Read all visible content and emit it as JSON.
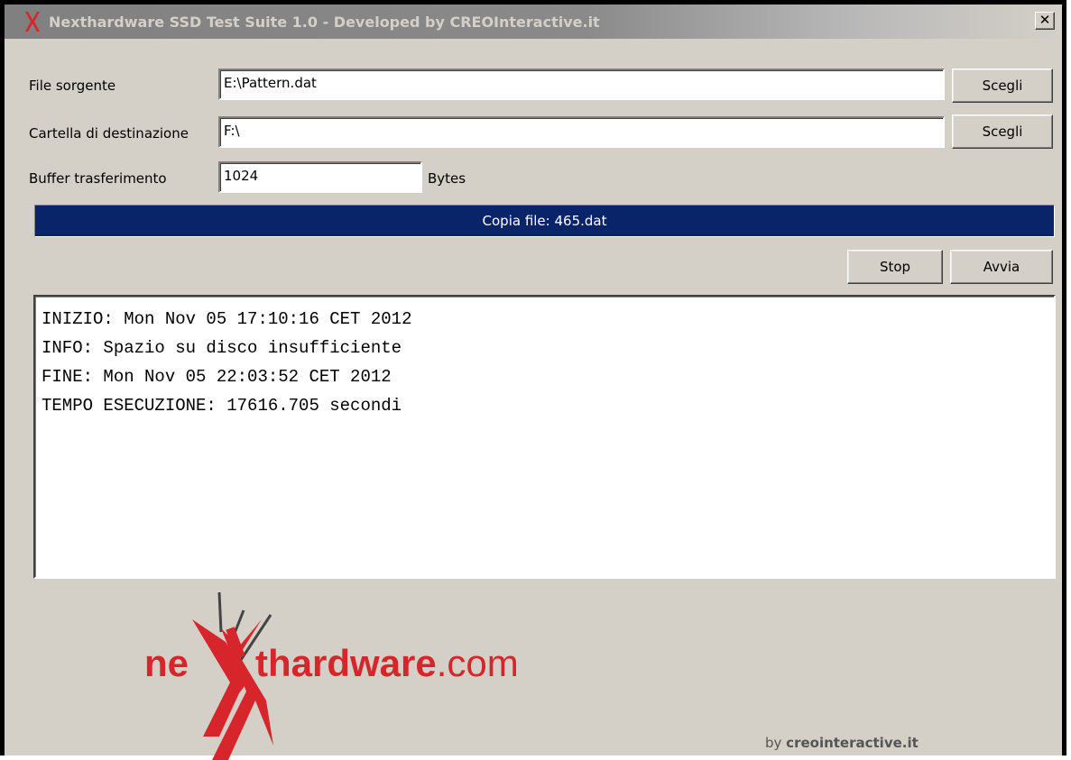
{
  "window": {
    "title": "Nexthardware SSD Test Suite 1.0 - Developed by CREOInteractive.it",
    "close_label": "✕"
  },
  "form": {
    "source_label": "File sorgente",
    "source_value": "E:\\Pattern.dat",
    "source_button": "Scegli",
    "dest_label": "Cartella di destinazione",
    "dest_value": "F:\\",
    "dest_button": "Scegli",
    "buffer_label": "Buffer trasferimento",
    "buffer_value": "1024",
    "buffer_unit": "Bytes"
  },
  "progress": {
    "text": "Copia file: 465.dat",
    "fraction": 1.0
  },
  "actions": {
    "stop_label": "Stop",
    "start_label": "Avvia"
  },
  "log": {
    "lines": [
      "INIZIO: Mon Nov 05 17:10:16 CET 2012",
      "INFO: Spazio su disco insufficiente",
      "FINE: Mon Nov 05 22:03:52 CET 2012",
      "TEMPO ESECUZIONE: 17616.705 secondi"
    ]
  },
  "branding": {
    "logo_prefix": "ne",
    "logo_rest": "thardware",
    "logo_suffix": ".com",
    "byline_prefix": "by ",
    "byline_brand": "creointeractive.it"
  },
  "colors": {
    "window_bg": "#d4d0c8",
    "progress_fill": "#0a246a",
    "logo_red": "#d7262b"
  }
}
